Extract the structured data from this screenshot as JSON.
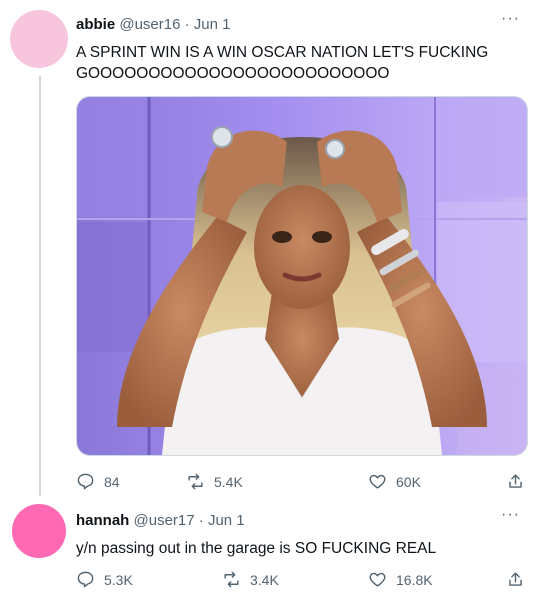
{
  "tweets": [
    {
      "name": "abbie",
      "handle": "@user16",
      "separator": "·",
      "date": "Jun 1",
      "text": "A SPRINT WIN IS A WIN OSCAR NATION LET'S FUCKING GOOOOOOOOOOOOOOOOOOOOOOOOO",
      "more": "···",
      "avatar_color": "#f7c6dd",
      "stats": {
        "replies": "84",
        "retweets": "5.4K",
        "likes": "60K"
      }
    },
    {
      "name": "hannah",
      "handle": "@user17",
      "separator": "·",
      "date": "Jun 1",
      "text": "y/n passing out in the garage is SO FUCKING REAL",
      "more": "···",
      "avatar_color": "#ff69b4",
      "stats": {
        "replies": "5.3K",
        "retweets": "3.4K",
        "likes": "16.8K"
      }
    }
  ],
  "icons": [
    "reply-icon",
    "retweet-icon",
    "like-icon",
    "share-icon",
    "more-icon"
  ]
}
